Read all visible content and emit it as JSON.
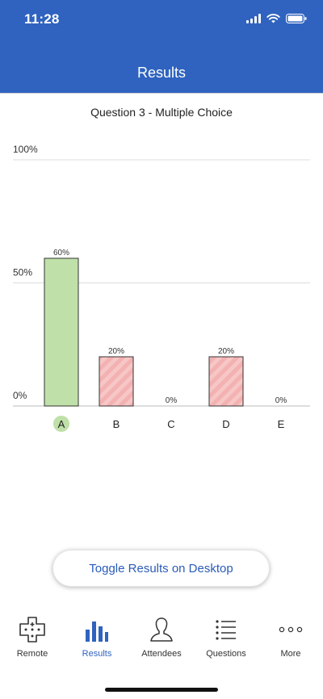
{
  "status_bar": {
    "time": "11:28"
  },
  "header": {
    "title": "Results"
  },
  "colors": {
    "header_bg": "#2f63bf",
    "correct_fill": "#bfe0a8",
    "incorrect_fill": "#f3b1b1",
    "accent": "#2f63bf"
  },
  "chart_data": {
    "type": "bar",
    "title": "Question 3 - Multiple Choice",
    "categories": [
      "A",
      "B",
      "C",
      "D",
      "E"
    ],
    "values": [
      60,
      20,
      0,
      20,
      0
    ],
    "value_labels": [
      "60%",
      "20%",
      "0%",
      "20%",
      "0%"
    ],
    "correct": [
      true,
      false,
      false,
      false,
      false
    ],
    "ylim": [
      0,
      100
    ],
    "yticks": [
      0,
      50,
      100
    ],
    "ytick_labels": [
      "0%",
      "50%",
      "100%"
    ],
    "grid": true
  },
  "toggle_button": {
    "label": "Toggle Results on Desktop"
  },
  "tabs": [
    {
      "label": "Remote",
      "icon": "remote-icon",
      "active": false
    },
    {
      "label": "Results",
      "icon": "results-icon",
      "active": true
    },
    {
      "label": "Attendees",
      "icon": "attendees-icon",
      "active": false
    },
    {
      "label": "Questions",
      "icon": "questions-icon",
      "active": false
    },
    {
      "label": "More",
      "icon": "more-icon",
      "active": false
    }
  ]
}
